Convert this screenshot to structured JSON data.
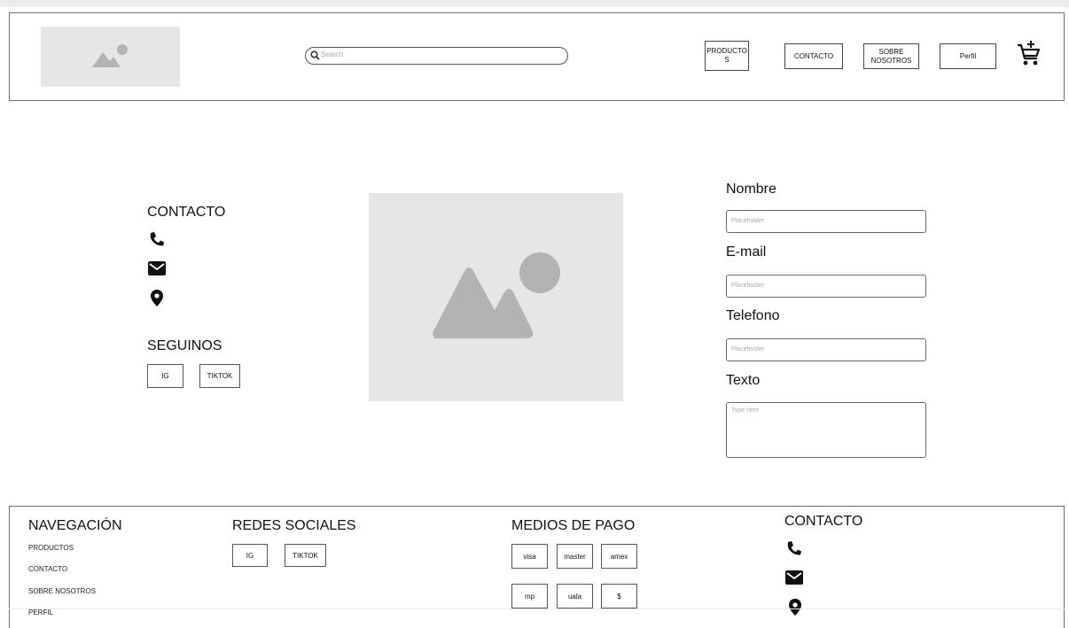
{
  "header": {
    "logo_icon": "image-placeholder-icon",
    "search": {
      "placeholder": "Search"
    },
    "nav": [
      "PRODUCTO S",
      "CONTACTO",
      "SOBRE NOSOTROS",
      "Perfil"
    ],
    "cart_icon": "cart-add-icon"
  },
  "contact_section": {
    "title": "CONTACTO",
    "icons": [
      "phone-icon",
      "mail-icon",
      "location-pin-icon"
    ],
    "follow_title": "SEGUINOS",
    "social": [
      "IG",
      "TIKTOK"
    ]
  },
  "hero": {
    "icon": "image-placeholder-icon"
  },
  "form": {
    "fields": [
      {
        "label": "Nombre",
        "placeholder": "Placeholder"
      },
      {
        "label": "E-mail",
        "placeholder": "Placeholder"
      },
      {
        "label": "Telefono",
        "placeholder": "Placeholder"
      }
    ],
    "text": {
      "label": "Texto",
      "placeholder": "Type here"
    }
  },
  "footer": {
    "nav": {
      "title": "NAVEGACIÓN",
      "links": [
        "PRODUCTOS",
        "CONTACTO",
        "SOBRE NOSOTROS",
        "PERFIL"
      ]
    },
    "social": {
      "title": "REDES SOCIALES",
      "buttons": [
        "IG",
        "TIKTOK"
      ]
    },
    "payment": {
      "title": "MEDIOS DE PAGO",
      "methods": [
        "visa",
        "master",
        "amex",
        "mp",
        "uala",
        "$"
      ]
    },
    "contact": {
      "title": "CONTACTO",
      "icons": [
        "phone-icon",
        "mail-icon",
        "location-pin-icon"
      ]
    }
  },
  "colors": {
    "placeholder_bg": "#e6e6e6",
    "placeholder_shape": "#b3b3b3",
    "border": "#6b6b6b"
  }
}
